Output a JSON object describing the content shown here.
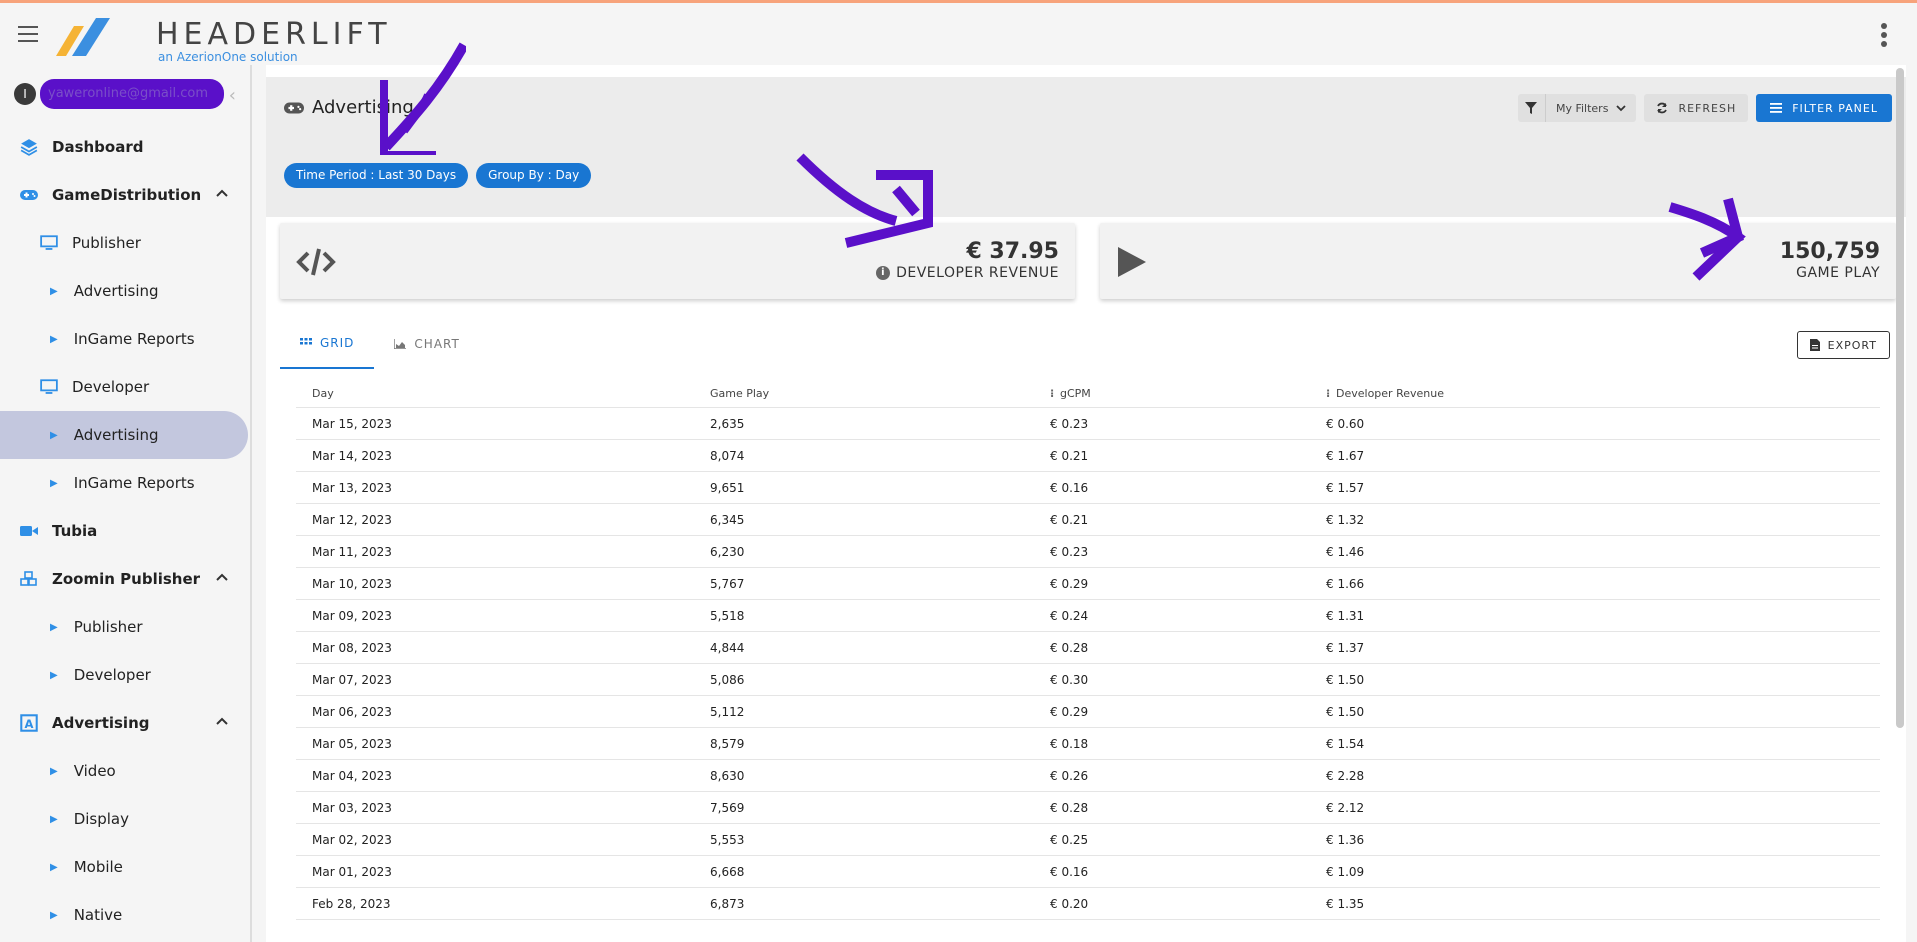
{
  "header": {
    "brand": "HEADERLIFT",
    "tagline": "an AzerionOne solution"
  },
  "sidebar": {
    "user_initial": "I",
    "user_email": "yaweronline@gmail.com",
    "items": [
      {
        "label": "Dashboard",
        "icon": "layers-icon"
      },
      {
        "label": "GameDistribution",
        "icon": "gamepad-icon"
      },
      {
        "label": "Publisher",
        "icon": "monitor-icon"
      },
      {
        "label": "Advertising"
      },
      {
        "label": "InGame Reports"
      },
      {
        "label": "Developer",
        "icon": "monitor-icon"
      },
      {
        "label": "Advertising"
      },
      {
        "label": "InGame Reports"
      },
      {
        "label": "Tubia",
        "icon": "video-icon"
      },
      {
        "label": "Zoomin Publisher",
        "icon": "cubes-icon"
      },
      {
        "label": "Publisher"
      },
      {
        "label": "Developer"
      },
      {
        "label": "Advertising",
        "icon": "ad-icon"
      },
      {
        "label": "Video"
      },
      {
        "label": "Display"
      },
      {
        "label": "Mobile"
      },
      {
        "label": "Native"
      }
    ]
  },
  "main": {
    "title": "Advertising",
    "toolbar": {
      "my_filters": "My Filters",
      "refresh": "REFRESH",
      "filter_panel": "FILTER PANEL"
    },
    "chips": [
      "Time Period : Last 30 Days",
      "Group By : Day"
    ],
    "kpis": [
      {
        "value": "€ 37.95",
        "label": "DEVELOPER REVENUE"
      },
      {
        "value": "150,759",
        "label": "GAME PLAY"
      }
    ],
    "tabs": [
      "GRID",
      "CHART"
    ],
    "export": "EXPORT",
    "table": {
      "headers": [
        "Day",
        "Game Play",
        "gCPM",
        "Developer Revenue"
      ],
      "rows": [
        [
          "Mar 15, 2023",
          "2,635",
          "€ 0.23",
          "€ 0.60"
        ],
        [
          "Mar 14, 2023",
          "8,074",
          "€ 0.21",
          "€ 1.67"
        ],
        [
          "Mar 13, 2023",
          "9,651",
          "€ 0.16",
          "€ 1.57"
        ],
        [
          "Mar 12, 2023",
          "6,345",
          "€ 0.21",
          "€ 1.32"
        ],
        [
          "Mar 11, 2023",
          "6,230",
          "€ 0.23",
          "€ 1.46"
        ],
        [
          "Mar 10, 2023",
          "5,767",
          "€ 0.29",
          "€ 1.66"
        ],
        [
          "Mar 09, 2023",
          "5,518",
          "€ 0.24",
          "€ 1.31"
        ],
        [
          "Mar 08, 2023",
          "4,844",
          "€ 0.28",
          "€ 1.37"
        ],
        [
          "Mar 07, 2023",
          "5,086",
          "€ 0.30",
          "€ 1.50"
        ],
        [
          "Mar 06, 2023",
          "5,112",
          "€ 0.29",
          "€ 1.50"
        ],
        [
          "Mar 05, 2023",
          "8,579",
          "€ 0.18",
          "€ 1.54"
        ],
        [
          "Mar 04, 2023",
          "8,630",
          "€ 0.26",
          "€ 2.28"
        ],
        [
          "Mar 03, 2023",
          "7,569",
          "€ 0.28",
          "€ 2.12"
        ],
        [
          "Mar 02, 2023",
          "5,553",
          "€ 0.25",
          "€ 1.36"
        ],
        [
          "Mar 01, 2023",
          "6,668",
          "€ 0.16",
          "€ 1.09"
        ],
        [
          "Feb 28, 2023",
          "6,873",
          "€ 0.20",
          "€ 1.35"
        ]
      ]
    }
  },
  "colors": {
    "accent": "#1976d2",
    "active_nav": "#c3c7de",
    "annotation": "#5a10c9",
    "top_accent": "#f7a37b"
  }
}
